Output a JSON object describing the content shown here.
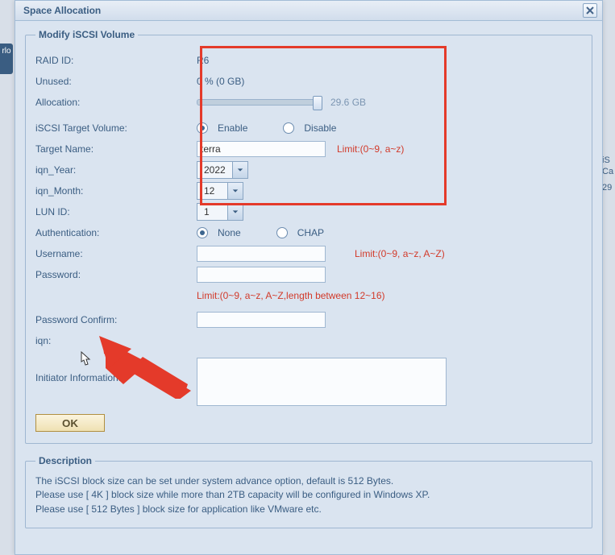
{
  "dialog": {
    "title": "Space Allocation"
  },
  "fieldset1": {
    "legend": "Modify iSCSI Volume"
  },
  "fields": {
    "raid_id": {
      "label": "RAID ID:",
      "value": "R6"
    },
    "unused": {
      "label": "Unused:",
      "value": "0 % (0 GB)"
    },
    "allocation": {
      "label": "Allocation:",
      "slider_value": "29.6 GB"
    },
    "target_volume": {
      "label": "iSCSI Target Volume:",
      "enable": "Enable",
      "disable": "Disable"
    },
    "target_name": {
      "label": "Target Name:",
      "value": "terra",
      "limit": "Limit:(0~9, a~z)"
    },
    "iqn_year": {
      "label": "iqn_Year:",
      "value": "2022"
    },
    "iqn_month": {
      "label": "iqn_Month:",
      "value": "12"
    },
    "lun_id": {
      "label": "LUN ID:",
      "value": "1"
    },
    "auth": {
      "label": "Authentication:",
      "none": "None",
      "chap": "CHAP"
    },
    "username": {
      "label": "Username:",
      "limit": "Limit:(0~9, a~z, A~Z)"
    },
    "password": {
      "label": "Password:",
      "limit": "Limit:(0~9, a~z, A~Z,length between 12~16)"
    },
    "password_confirm": {
      "label": "Password Confirm:"
    },
    "iqn": {
      "label": "iqn:"
    },
    "initiator": {
      "label": "Initiator Information:"
    }
  },
  "buttons": {
    "ok": "OK"
  },
  "description": {
    "legend": "Description",
    "line1": "The iSCSI block size can be set under system advance option, default is 512 Bytes.",
    "line2": "Please use [ 4K ] block size while more than 2TB capacity will be configured in Windows XP.",
    "line3": "Please use [ 512 Bytes ] block size for application like VMware etc."
  },
  "bg": {
    "left": "rlo",
    "r1": "iS",
    "r2": "Ca",
    "r3": "29"
  }
}
